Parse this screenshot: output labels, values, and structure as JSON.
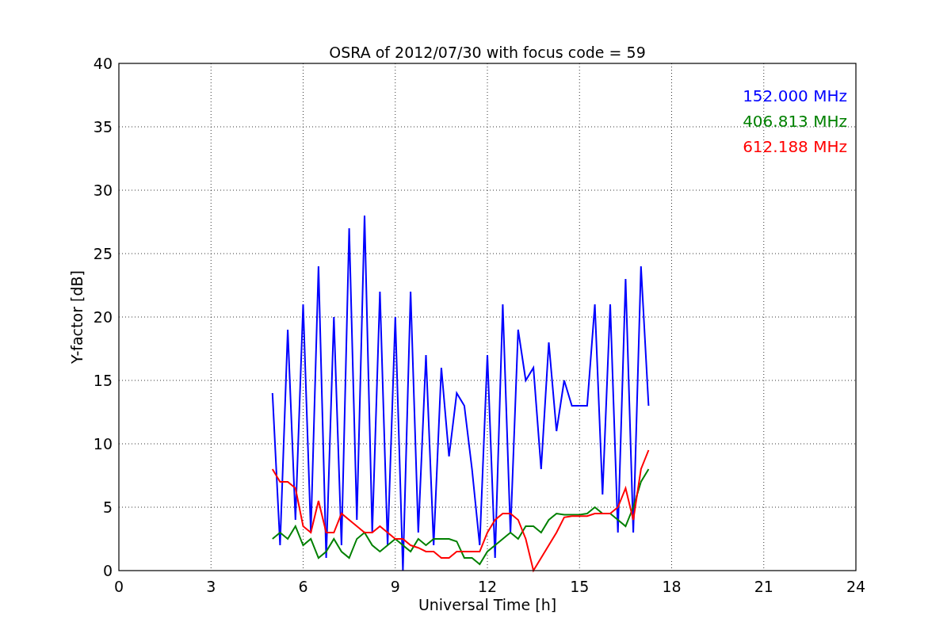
{
  "chart_data": {
    "type": "line",
    "title": "OSRA of 2012/07/30 with focus code = 59",
    "xlabel": "Universal Time [h]",
    "ylabel": "Y-factor [dB]",
    "x": [
      5.0,
      5.25,
      5.5,
      5.75,
      6.0,
      6.25,
      6.5,
      6.75,
      7.0,
      7.25,
      7.5,
      7.75,
      8.0,
      8.25,
      8.5,
      8.75,
      9.0,
      9.25,
      9.5,
      9.75,
      10.0,
      10.25,
      10.5,
      10.75,
      11.0,
      11.25,
      11.5,
      11.75,
      12.0,
      12.25,
      12.5,
      12.75,
      13.0,
      13.25,
      13.5,
      13.75,
      14.0,
      14.25,
      14.5,
      14.75,
      15.0,
      15.25,
      15.5,
      15.75,
      16.0,
      16.25,
      16.5,
      16.75,
      17.0,
      17.25
    ],
    "series": [
      {
        "name": "152.000 MHz",
        "color": "#0000ff",
        "values": [
          14,
          2,
          19,
          4,
          21,
          3,
          24,
          1,
          20,
          2,
          27,
          4,
          28,
          3,
          22,
          2,
          20,
          0,
          22,
          3,
          17,
          2,
          16,
          9,
          14,
          13,
          8,
          2,
          17,
          1,
          21,
          3,
          19,
          15,
          16,
          8,
          18,
          11,
          15,
          13,
          13,
          13,
          21,
          6,
          21,
          3,
          23,
          3,
          24,
          13
        ]
      },
      {
        "name": "406.813 MHz",
        "color": "#008000",
        "values": [
          2.5,
          3,
          2.5,
          3.5,
          2,
          2.5,
          1,
          1.5,
          2.5,
          1.5,
          1,
          2.5,
          3,
          2,
          1.5,
          2,
          2.5,
          2,
          1.5,
          2.5,
          2,
          2.5,
          2.5,
          2.5,
          2.3,
          1,
          1,
          0.5,
          1.5,
          2,
          2.5,
          3,
          2.5,
          3.5,
          3.5,
          3,
          4,
          4.5,
          4.4,
          4.4,
          4.4,
          4.5,
          5,
          4.5,
          4.5,
          4,
          3.5,
          5,
          7,
          8
        ]
      },
      {
        "name": "612.188 MHz",
        "color": "#ff0000",
        "values": [
          8,
          7,
          7,
          6.5,
          3.5,
          3,
          5.5,
          3,
          3,
          4.5,
          4,
          3.5,
          3,
          3,
          3.5,
          3,
          2.5,
          2.5,
          2,
          1.8,
          1.5,
          1.5,
          1,
          1,
          1.5,
          1.5,
          1.5,
          1.5,
          3,
          4,
          4.5,
          4.5,
          4,
          2.5,
          0,
          1,
          2,
          3,
          4.2,
          4.3,
          4.3,
          4.3,
          4.5,
          4.5,
          4.5,
          5,
          6.5,
          4,
          8,
          9.5
        ]
      }
    ],
    "grid": true,
    "xlim": [
      0,
      24
    ],
    "ylim": [
      0,
      40
    ],
    "xticks": [
      0,
      3,
      6,
      9,
      12,
      15,
      18,
      21,
      24
    ],
    "yticks": [
      0,
      5,
      10,
      15,
      20,
      25,
      30,
      35,
      40
    ]
  }
}
